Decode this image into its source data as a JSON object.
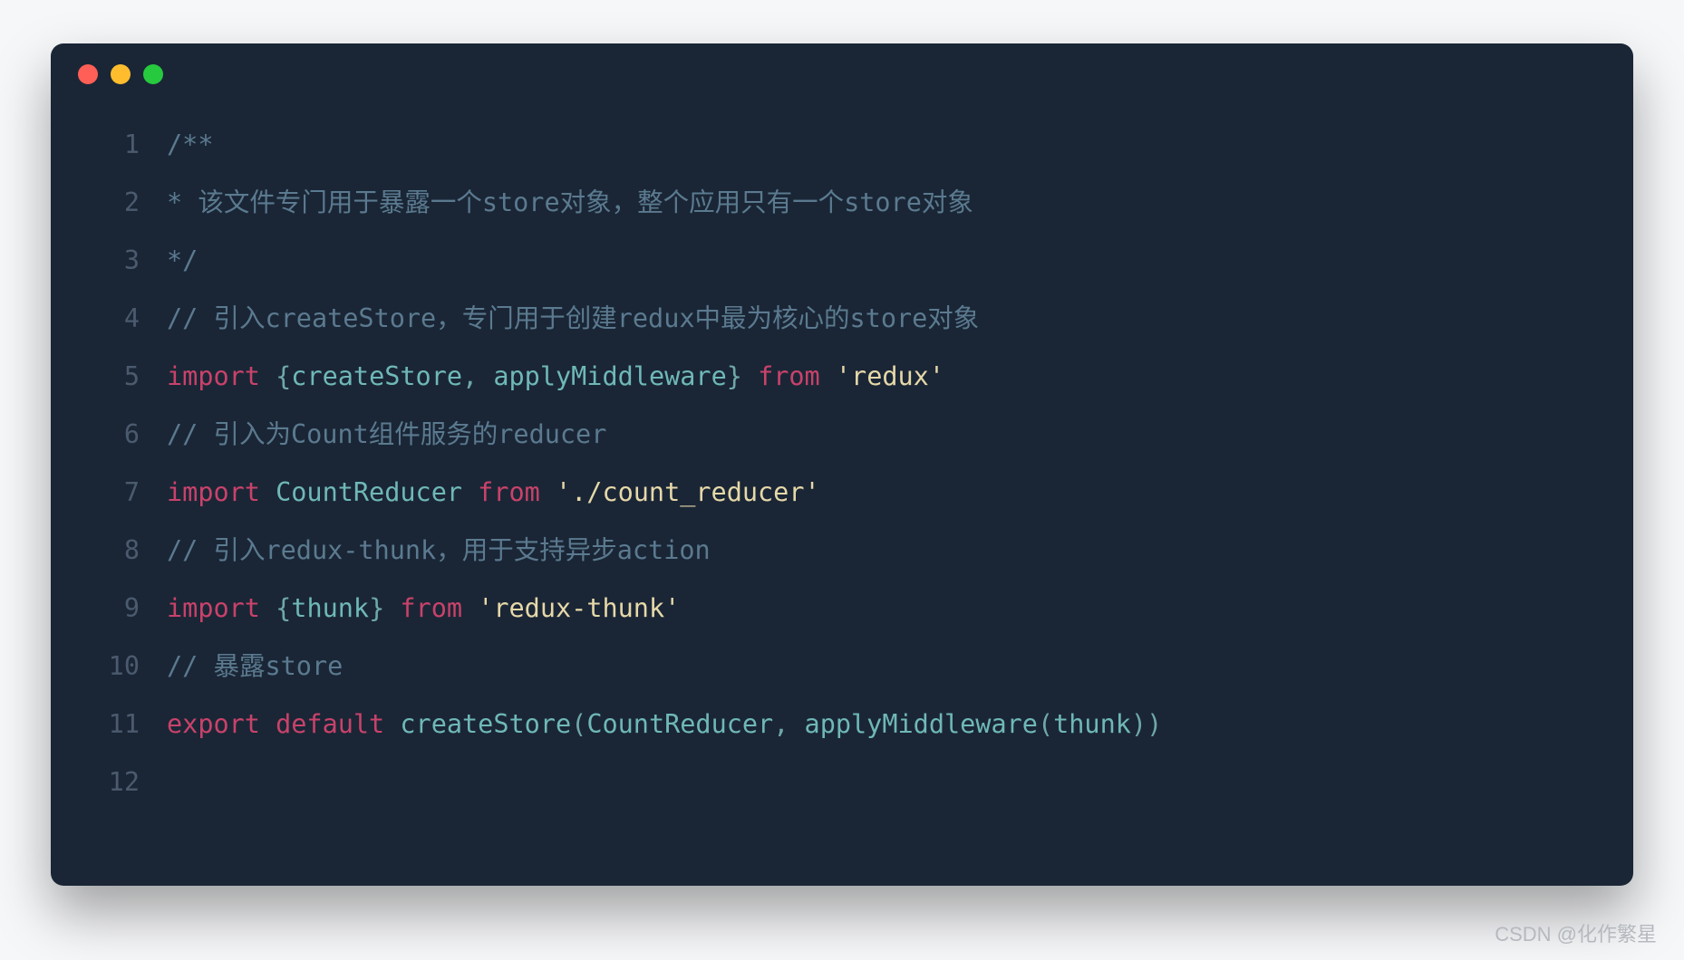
{
  "window": {
    "dots": [
      "close",
      "minimize",
      "zoom"
    ]
  },
  "watermark": "CSDN @化作繁星",
  "code": {
    "lines": [
      {
        "n": "1",
        "tokens": [
          [
            "/**",
            "c-comment"
          ]
        ]
      },
      {
        "n": "2",
        "tokens": [
          [
            "* 该文件专门用于暴露一个store对象，整个应用只有一个store对象",
            "c-comment"
          ]
        ]
      },
      {
        "n": "3",
        "tokens": [
          [
            "*/",
            "c-comment"
          ]
        ]
      },
      {
        "n": "4",
        "tokens": [
          [
            "// 引入createStore，专门用于创建redux中最为核心的store对象",
            "c-comment"
          ]
        ]
      },
      {
        "n": "5",
        "tokens": [
          [
            "import ",
            "c-keyword"
          ],
          [
            "{",
            "c-punct"
          ],
          [
            "createStore",
            "c-ident"
          ],
          [
            ", ",
            "c-punct"
          ],
          [
            "applyMiddleware",
            "c-ident"
          ],
          [
            "}",
            "c-punct"
          ],
          [
            " from ",
            "c-keyword"
          ],
          [
            "'redux'",
            "c-string"
          ]
        ]
      },
      {
        "n": "6",
        "tokens": [
          [
            "// 引入为Count组件服务的reducer",
            "c-comment"
          ]
        ]
      },
      {
        "n": "7",
        "tokens": [
          [
            "import ",
            "c-keyword"
          ],
          [
            "CountReducer",
            "c-ident"
          ],
          [
            " from ",
            "c-keyword"
          ],
          [
            "'./count_reducer'",
            "c-string"
          ]
        ]
      },
      {
        "n": "8",
        "tokens": [
          [
            "// 引入redux-thunk，用于支持异步action",
            "c-comment"
          ]
        ]
      },
      {
        "n": "9",
        "tokens": [
          [
            "import ",
            "c-keyword"
          ],
          [
            "{",
            "c-punct"
          ],
          [
            "thunk",
            "c-ident"
          ],
          [
            "}",
            "c-punct"
          ],
          [
            " from ",
            "c-keyword"
          ],
          [
            "'redux-thunk'",
            "c-string"
          ]
        ]
      },
      {
        "n": "10",
        "tokens": [
          [
            "// 暴露store",
            "c-comment"
          ]
        ]
      },
      {
        "n": "11",
        "tokens": [
          [
            "export ",
            "c-keyword"
          ],
          [
            "default ",
            "c-keyword"
          ],
          [
            "createStore",
            "c-ident"
          ],
          [
            "(",
            "c-punct"
          ],
          [
            "CountReducer",
            "c-ident"
          ],
          [
            ", ",
            "c-punct"
          ],
          [
            "applyMiddleware",
            "c-ident"
          ],
          [
            "(",
            "c-punct"
          ],
          [
            "thunk",
            "c-ident"
          ],
          [
            "))",
            "c-punct"
          ]
        ]
      },
      {
        "n": "12",
        "tokens": []
      }
    ]
  }
}
